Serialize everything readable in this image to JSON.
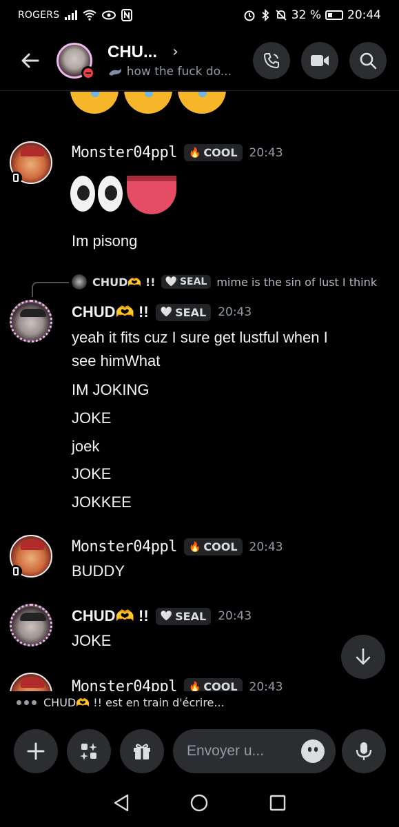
{
  "status_bar": {
    "carrier": "ROGERS",
    "battery": "32 %",
    "time": "20:44"
  },
  "header": {
    "title": "CHU...",
    "subtitle": "how the fuck do..."
  },
  "messages": [
    {
      "author": "Monster04ppl",
      "tag": "COOL",
      "time": "20:43",
      "lines": [
        "Im pisong"
      ]
    },
    {
      "reply": {
        "author": "CHUD🫶 !!",
        "tag": "SEAL",
        "text": "mime is the sin of lust I think"
      },
      "author": "CHUD🫶 !!",
      "tag": "SEAL",
      "time": "20:43",
      "lines": [
        "yeah it fits cuz I sure get lustful when I",
        "see himWhat",
        "IM JOKING",
        "JOKE",
        "joek",
        "JOKE",
        "JOKKEE"
      ]
    },
    {
      "author": "Monster04ppl",
      "tag": "COOL",
      "time": "20:43",
      "lines": [
        "BUDDY"
      ]
    },
    {
      "author": "CHUD🫶 !!",
      "tag": "SEAL",
      "time": "20:43",
      "lines": [
        "JOKE"
      ]
    },
    {
      "author": "Monster04ppl",
      "tag": "COOL",
      "time": "20:43",
      "lines": []
    }
  ],
  "typing": {
    "text": "CHUD🫶 !! est en train d'écrire..."
  },
  "composer": {
    "placeholder": "Envoyer u..."
  },
  "colors": {
    "background": "#000000",
    "surface": "#2b2d31",
    "muted_text": "#949ba4",
    "dnd_red": "#f23f43"
  }
}
